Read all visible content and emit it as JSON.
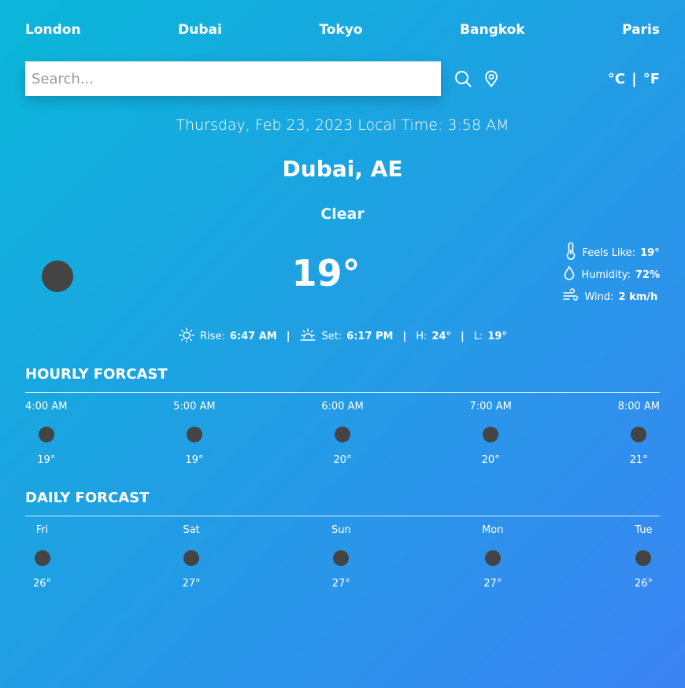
{
  "cities": [
    "London",
    "Dubai",
    "Tokyo",
    "Bangkok",
    "Paris"
  ],
  "search": {
    "placeholder": "Search..."
  },
  "units": {
    "celsius": "°C",
    "separator": "|",
    "fahrenheit": "°F"
  },
  "date_line": "Thursday, Feb 23, 2023 Local Time: 3:58 AM",
  "location": "Dubai, AE",
  "condition": "Clear",
  "temperature": "19°",
  "details": {
    "feels_like_label": "Feels Like:",
    "feels_like_value": "19°",
    "humidity_label": "Humidity:",
    "humidity_value": "72%",
    "wind_label": "Wind:",
    "wind_value": "2 km/h"
  },
  "sun": {
    "rise_label": "Rise:",
    "rise_value": "6:47 AM",
    "set_label": "Set:",
    "set_value": "6:17 PM",
    "high_label": "H:",
    "high_value": "24°",
    "low_label": "L:",
    "low_value": "19°",
    "separator": "|"
  },
  "hourly": {
    "title": "HOURLY FORCAST",
    "items": [
      {
        "label": "4:00 AM",
        "temp": "19°"
      },
      {
        "label": "5:00 AM",
        "temp": "19°"
      },
      {
        "label": "6:00 AM",
        "temp": "20°"
      },
      {
        "label": "7:00 AM",
        "temp": "20°"
      },
      {
        "label": "8:00 AM",
        "temp": "21°"
      }
    ]
  },
  "daily": {
    "title": "DAILY FORCAST",
    "items": [
      {
        "label": "Fri",
        "temp": "26°"
      },
      {
        "label": "Sat",
        "temp": "27°"
      },
      {
        "label": "Sun",
        "temp": "27°"
      },
      {
        "label": "Mon",
        "temp": "27°"
      },
      {
        "label": "Tue",
        "temp": "26°"
      }
    ]
  },
  "colors": {
    "gradient_start": "#0ab7d9",
    "gradient_end": "#3b84f4",
    "icon_placeholder": "#444444"
  },
  "icons": [
    "search-icon",
    "location-pin-icon",
    "thermometer-icon",
    "droplet-icon",
    "wind-icon",
    "sunrise-icon",
    "sunset-icon"
  ]
}
